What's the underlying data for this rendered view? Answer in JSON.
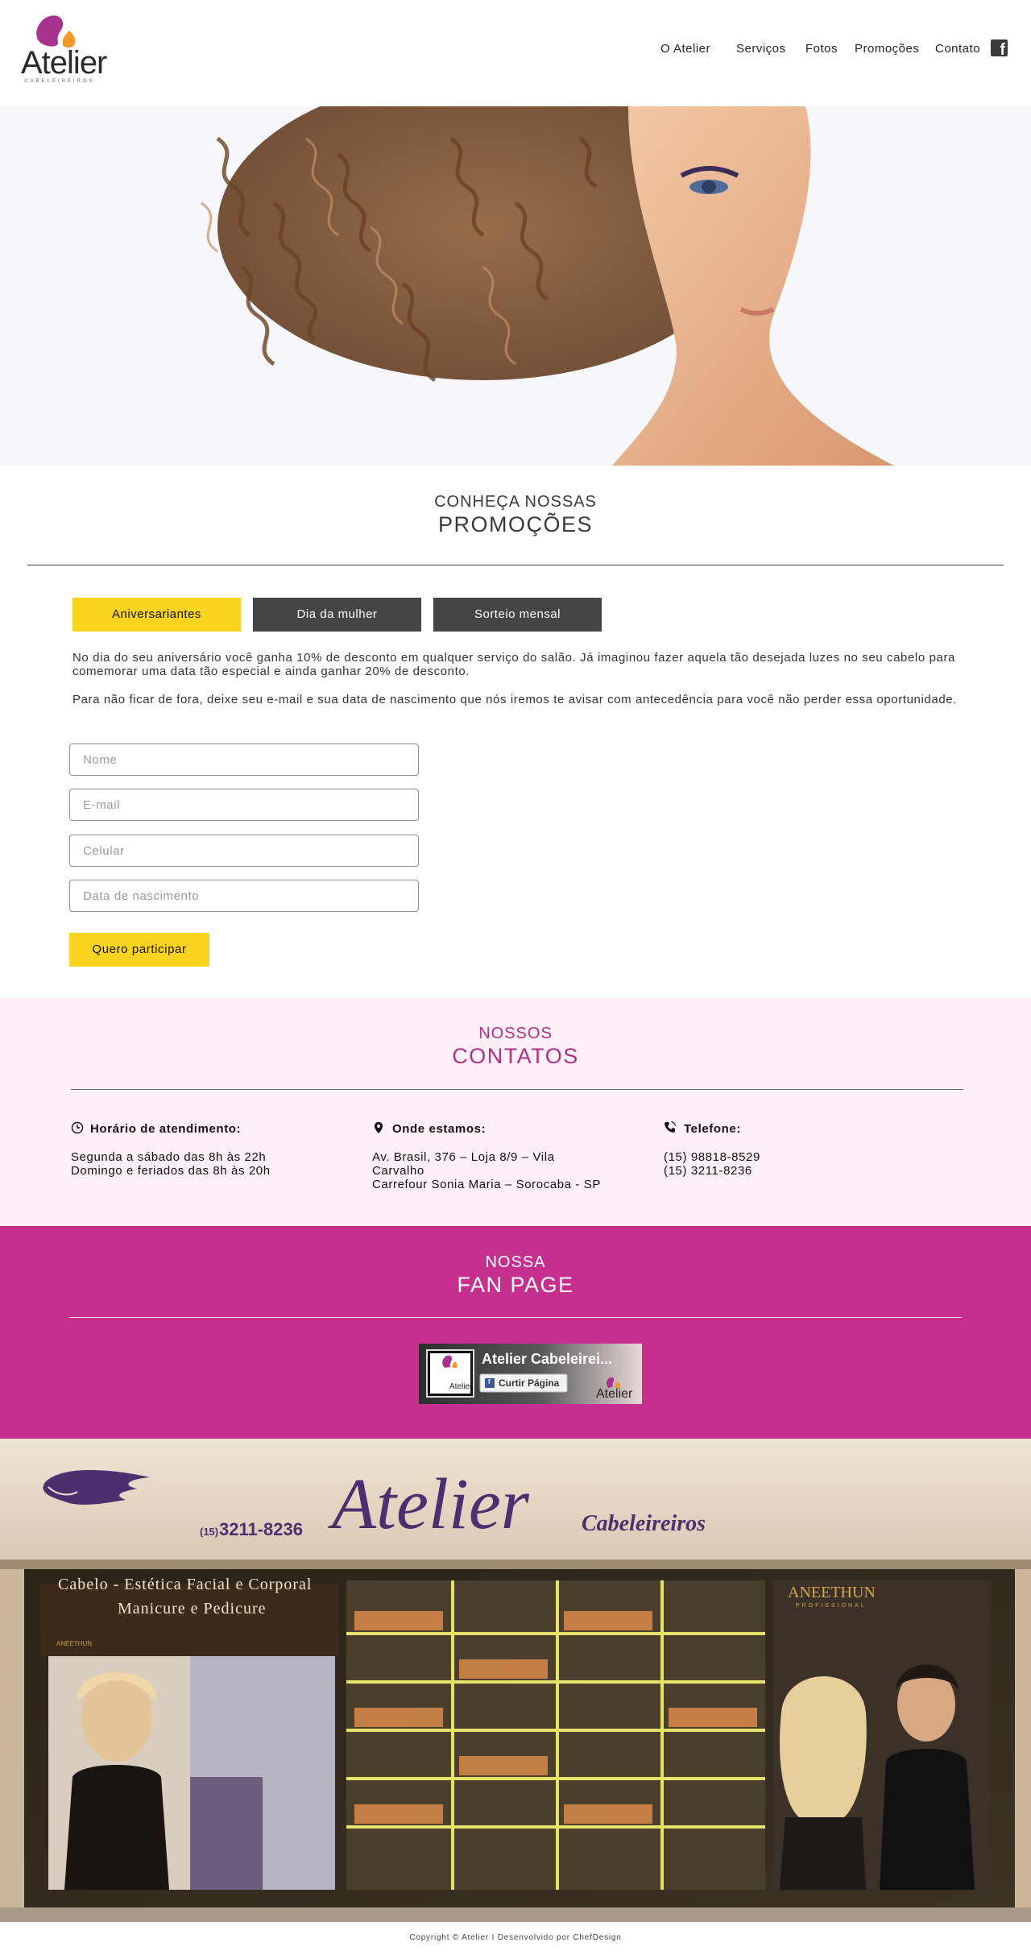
{
  "brand": {
    "logo_text": "Atelier",
    "logo_sub": "CABELEIREIROS",
    "accent": "#c5308f",
    "yellow": "#f8d31f"
  },
  "nav": {
    "items": [
      "O Atelier",
      "Serviços",
      "Fotos",
      "Promoções",
      "Contato"
    ],
    "facebook_icon": "facebook-icon"
  },
  "promo": {
    "kicker": "CONHEÇA NOSSAS",
    "title": "PROMOÇÕES",
    "tabs": [
      "Aniversariantes",
      "Dia da mulher",
      "Sorteio mensal"
    ],
    "active_tab": "Aniversariantes",
    "paragraph1": "No dia do seu aniversário você ganha 10% de desconto em qualquer serviço do salão. Já imaginou fazer aquela tão desejada luzes no seu cabelo para comemorar uma data tão especial e ainda ganhar 20% de desconto.",
    "paragraph2": "Para não ficar de fora, deixe seu e-mail e sua data de nascimento que nós iremos te avisar com antecedência para você não perder essa oportunidade.",
    "form": {
      "name_placeholder": "Nome",
      "email_placeholder": "E-mail",
      "phone_placeholder": "Celular",
      "birth_placeholder": "Data de nascimento",
      "submit_label": "Quero participar"
    }
  },
  "contacts": {
    "kicker": "NOSSOS",
    "title": "CONTATOS",
    "hours": {
      "heading": "Horário de atendimento:",
      "line1": "Segunda a sábado das 8h às 22h",
      "line2": "Domingo e feriados das 8h às 20h"
    },
    "location": {
      "heading": "Onde estamos:",
      "line1": "Av. Brasil, 376 – Loja 8/9 – Vila",
      "line2": "Carvalho",
      "line3": "Carrefour Sonia Maria – Sorocaba - SP"
    },
    "phone": {
      "heading": "Telefone:",
      "line1": "(15) 98818-8529",
      "line2": "(15) 3211-8236"
    }
  },
  "fanpage": {
    "kicker": "NOSSA",
    "title": "FAN PAGE",
    "card_title": "Atelier Cabeleirei...",
    "like_label": "Curtir Página",
    "logo_text": "Atelier"
  },
  "storefront": {
    "phone_prefix": "(15)",
    "phone": "3211-8236",
    "sign_name": "Atelier",
    "sign_sub": "Cabeleireiros",
    "services_line1": "Cabelo - Estética Facial e Corporal",
    "services_line2": "Manicure e Pedicure",
    "brand_left": "ANEETHUN",
    "brand_right": "ANEETHUN",
    "brand_right_sub": "PROFISSIONAL"
  },
  "footer": {
    "text": "Copyright © Atelier I Desenvolvido por ChefDesign"
  }
}
